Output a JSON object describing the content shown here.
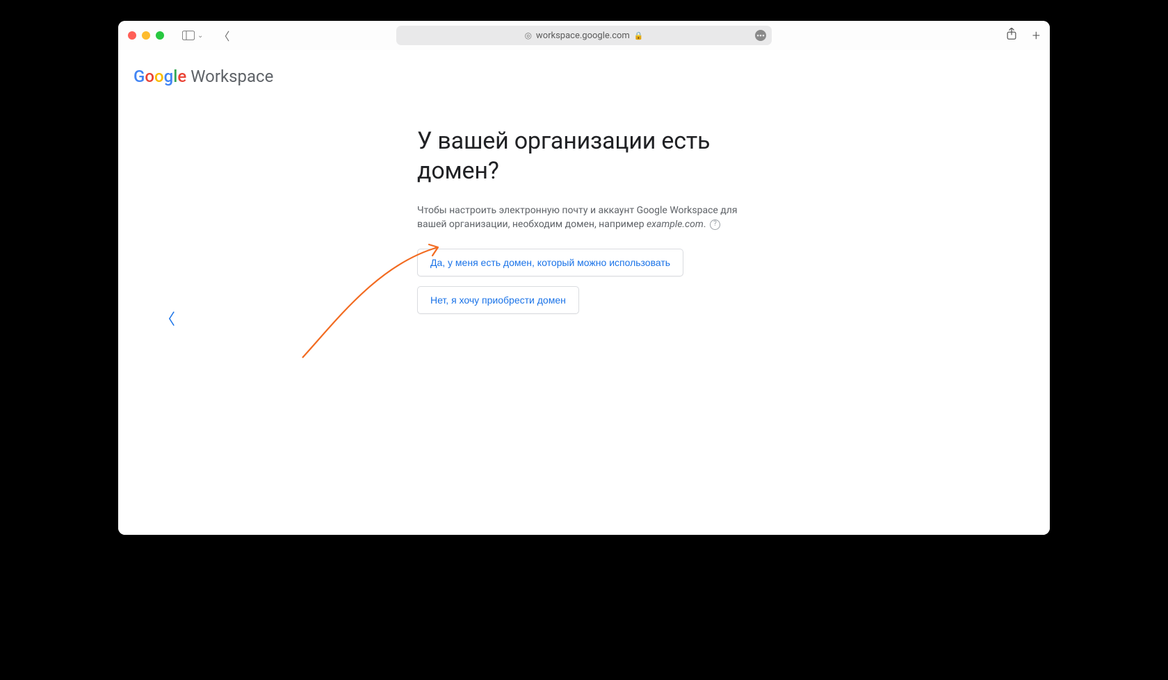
{
  "browser": {
    "address": "workspace.google.com"
  },
  "brand": {
    "g1": "G",
    "g2": "o",
    "g3": "o",
    "g4": "g",
    "g5": "l",
    "g6": "e",
    "workspace": "Workspace"
  },
  "main": {
    "heading": "У вашей организации есть домен?",
    "sub_prefix": "Чтобы настроить электронную почту и аккаунт Google Workspace для вашей организации, необходим домен, например ",
    "sub_example": "example.com",
    "sub_suffix": ".",
    "option_yes": "Да, у меня есть домен, который можно использовать",
    "option_no": "Нет, я хочу приобрести домен"
  }
}
